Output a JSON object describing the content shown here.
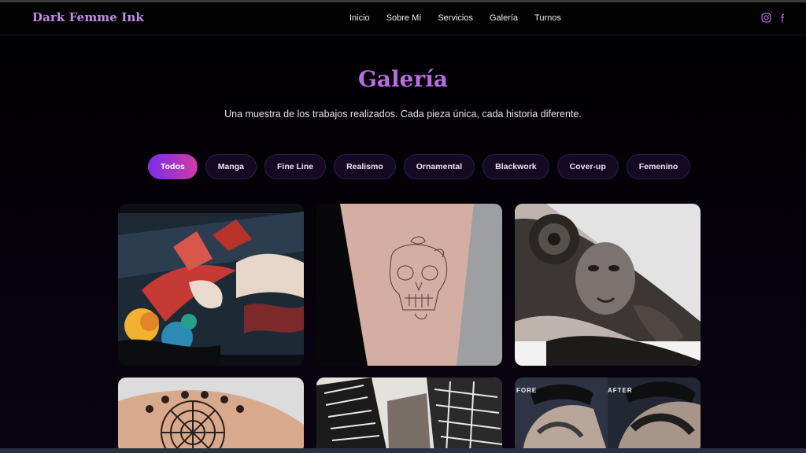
{
  "brand": {
    "name": "Dark Femme Ink"
  },
  "nav": {
    "items": [
      "Inicio",
      "Sobre Mí",
      "Servicios",
      "Galería",
      "Turnos"
    ]
  },
  "social": {
    "icons": [
      "instagram-icon",
      "facebook-icon"
    ]
  },
  "gallery": {
    "title": "Galería",
    "subtitle": "Una muestra de los trabajos realizados. Cada pieza única, cada historia diferente.",
    "filters": [
      "Todos",
      "Manga",
      "Fine Line",
      "Realismo",
      "Ornamental",
      "Blackwork",
      "Cover-up",
      "Femenino"
    ],
    "active_filter": "Todos",
    "items": [
      {
        "subject": "japanese-sleeve-tattoo"
      },
      {
        "subject": "fine-line-skull-tattoo"
      },
      {
        "subject": "realism-portrait-tattoo"
      },
      {
        "subject": "mandala-ornamental-tattoo"
      },
      {
        "subject": "blackwork-tribal-tattoo"
      },
      {
        "subject": "cover-up-before-after",
        "labels": [
          "FORE",
          "AFTER"
        ]
      }
    ]
  },
  "colors": {
    "accent": "#b76fe0",
    "pill_active_start": "#7a2ee8",
    "pill_active_end": "#d13aa8",
    "background": "#000000"
  }
}
